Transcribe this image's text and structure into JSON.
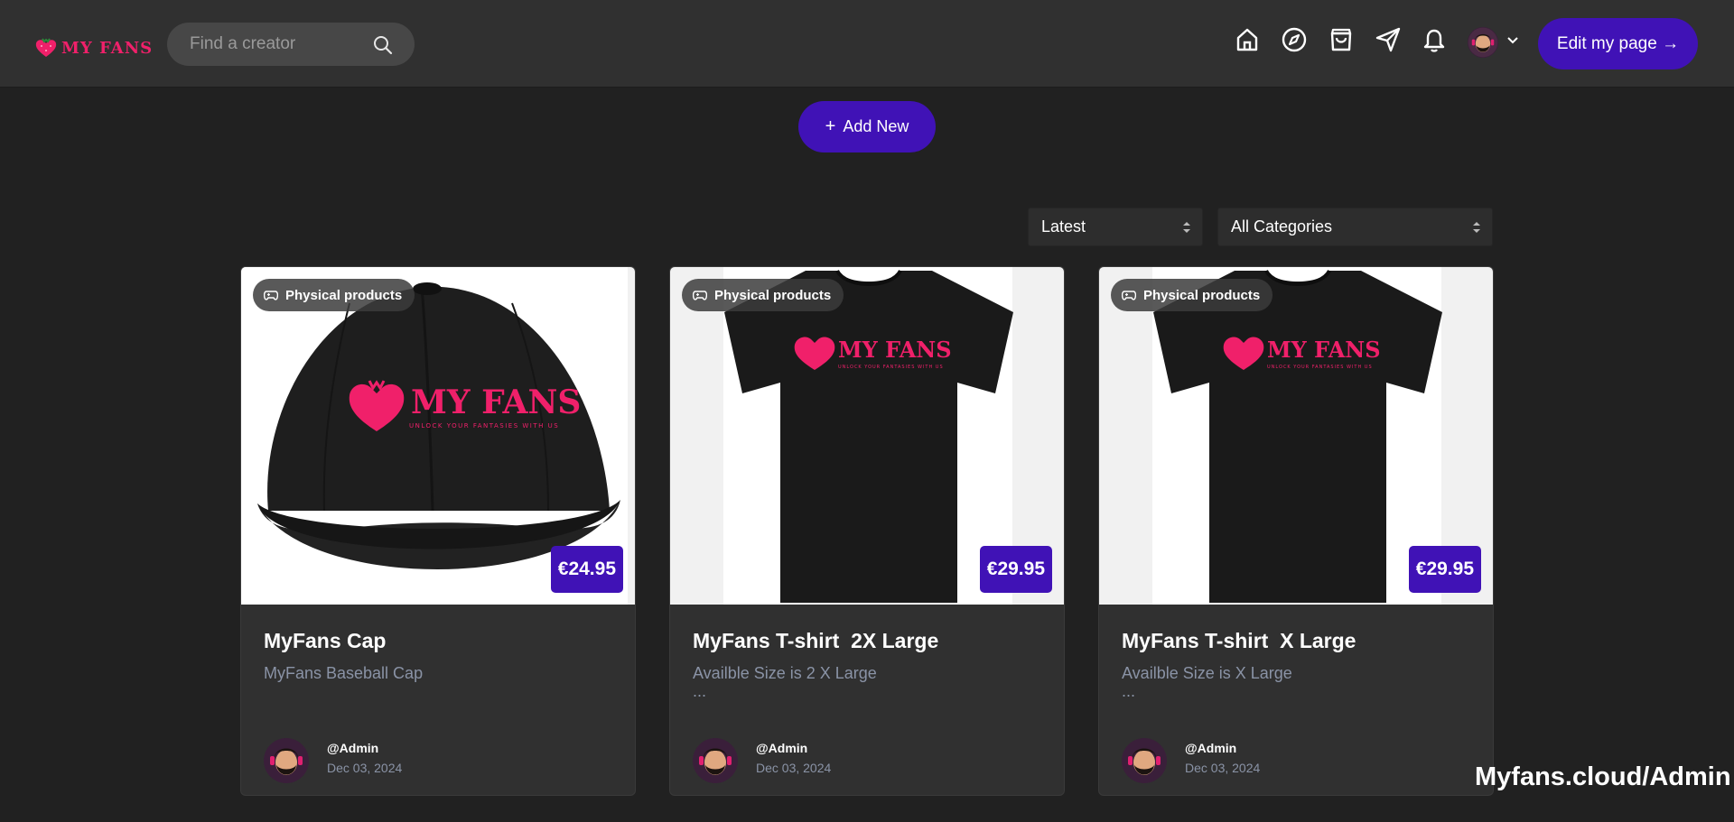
{
  "brand": {
    "logo_text": "MY FANS",
    "logo_color": "#f0206a"
  },
  "header": {
    "search": {
      "placeholder": "Find a creator",
      "value": ""
    },
    "nav_icons": [
      "home-icon",
      "compass-icon",
      "shopping-bag-icon",
      "send-icon",
      "bell-icon"
    ],
    "edit_button_label": "Edit my page →"
  },
  "toolbar": {
    "add_new_label": "Add New",
    "sort": {
      "selected": "Latest"
    },
    "category": {
      "selected": "All Categories"
    }
  },
  "products": [
    {
      "category": "Physical products",
      "price": "€24.95",
      "title": "MyFans Cap",
      "description": "MyFans Baseball Cap",
      "ellipsis": "",
      "author": "@Admin",
      "date": "Dec 03, 2024"
    },
    {
      "category": "Physical products",
      "price": "€29.95",
      "title": "MyFans T-shirt  2X Large",
      "description": "Availble Size is 2 X Large",
      "ellipsis": "...",
      "author": "@Admin",
      "date": "Dec 03, 2024"
    },
    {
      "category": "Physical products",
      "price": "€29.95",
      "title": "MyFans T-shirt  X Large",
      "description": "Availble Size is X Large",
      "ellipsis": "...",
      "author": "@Admin",
      "date": "Dec 03, 2024"
    }
  ],
  "watermark": "Myfans.cloud/Admin",
  "colors": {
    "accent": "#4012b6",
    "background": "#212121",
    "header": "#303030",
    "card": "#303030",
    "muted_text": "#8a93a6"
  }
}
